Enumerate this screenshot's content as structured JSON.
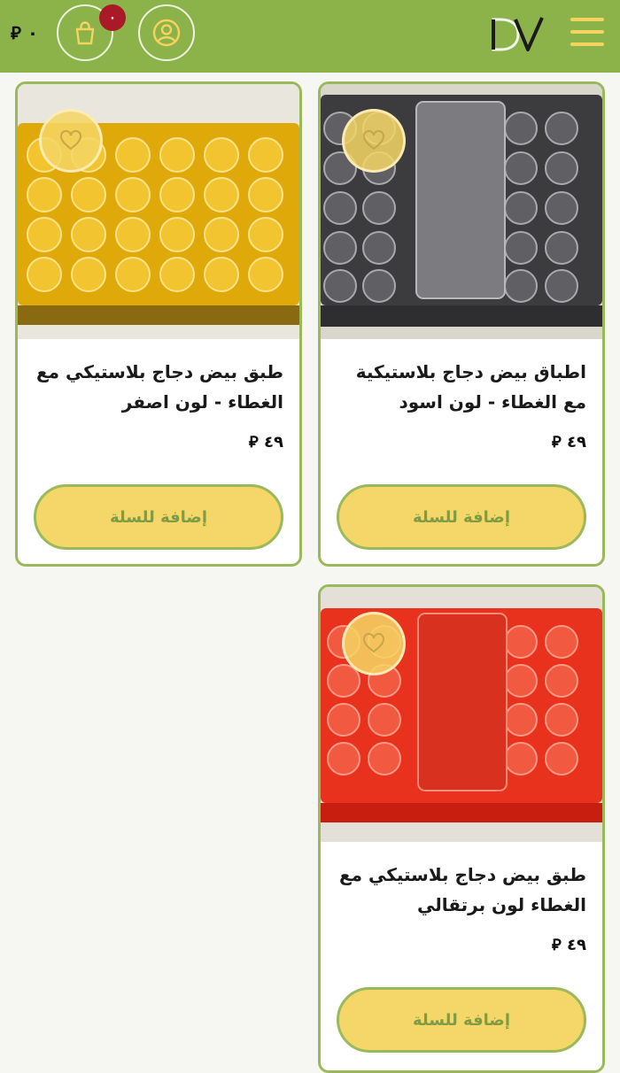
{
  "header": {
    "cart_badge": "٠",
    "cart_total": "٠ ⃁",
    "logo_text": "DV",
    "icons": [
      "shopping-bag-icon",
      "user-icon",
      "menu-icon"
    ],
    "colors": {
      "bar": "#8cb24a",
      "accent": "#f5d35f",
      "badge": "#a81a28"
    }
  },
  "products": [
    {
      "title": "اطباق بيض دجاج بلاستيكية مع الغطاء - لون اسود",
      "price": "٤٩ ⃁",
      "button": "إضافة للسلة",
      "image_color": "black"
    },
    {
      "title": "طبق بيض دجاج بلاستيكي مع الغطاء - لون اصفر",
      "price": "٤٩ ⃁",
      "button": "إضافة للسلة",
      "image_color": "yellow"
    },
    {
      "title": "طبق بيض دجاج بلاستيكي مع الغطاء لون برتقالي",
      "price": "٤٩ ⃁",
      "button": "إضافة للسلة",
      "image_color": "orange"
    }
  ]
}
